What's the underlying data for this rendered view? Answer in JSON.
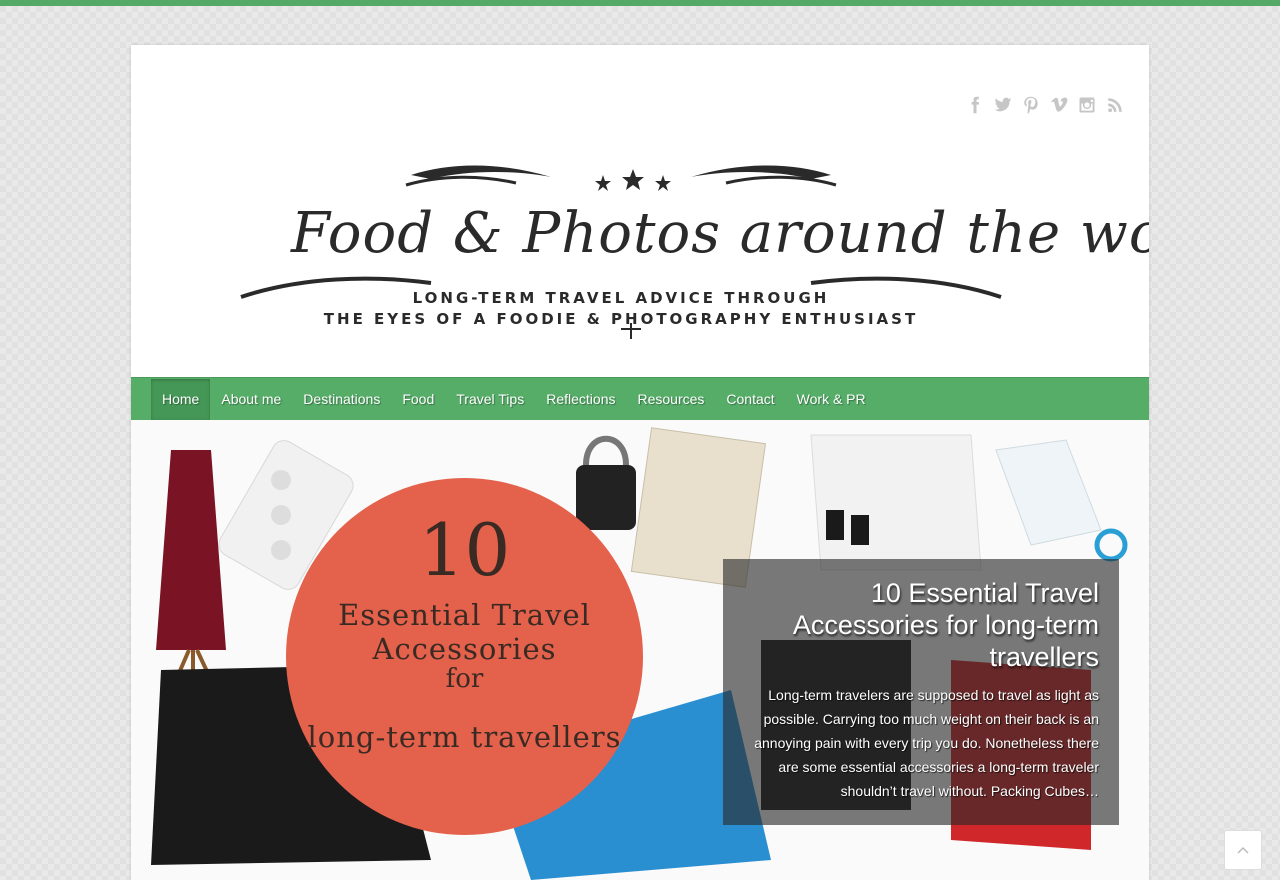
{
  "social": [
    {
      "name": "facebook-icon"
    },
    {
      "name": "twitter-icon"
    },
    {
      "name": "pinterest-icon"
    },
    {
      "name": "vimeo-icon"
    },
    {
      "name": "instagram-icon"
    },
    {
      "name": "rss-icon"
    }
  ],
  "logo": {
    "title": "Food & Photos around the world",
    "subtitle_line1": "LONG-TERM TRAVEL ADVICE THROUGH",
    "subtitle_line2": "THE EYES OF A FOODIE & PHOTOGRAPHY ENTHUSIAST"
  },
  "nav": {
    "items": [
      {
        "label": "Home"
      },
      {
        "label": "About me"
      },
      {
        "label": "Destinations"
      },
      {
        "label": "Food"
      },
      {
        "label": "Travel Tips"
      },
      {
        "label": "Reflections"
      },
      {
        "label": "Resources"
      },
      {
        "label": "Contact"
      },
      {
        "label": "Work & PR"
      }
    ],
    "active": "Home"
  },
  "hero": {
    "circle_number": "10",
    "circle_line1": "Essential Travel Accessories",
    "circle_line2": "for",
    "circle_line3": "long-term travellers",
    "title": "10 Essential Travel Accessories for long-term travellers",
    "excerpt": "Long-term travelers are supposed to travel as light as possible. Carrying too much weight on their back is an annoying pain with every trip you do. Nonetheless there are some essential accessories a long-term traveler shouldn’t travel without. Packing Cubes…"
  },
  "colors": {
    "accent": "#55ad68",
    "circle": "#e4614b"
  },
  "scroll_top_icon": "chevron-up-icon"
}
